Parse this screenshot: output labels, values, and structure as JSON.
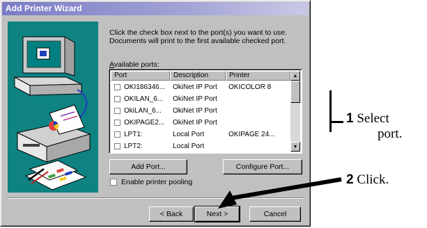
{
  "window": {
    "title": "Add Printer Wizard"
  },
  "instructions": "Click the check box next to the port(s) you want to use. Documents will print to the first available checked port.",
  "available_ports_label": {
    "accel": "A",
    "rest": "vailable ports:"
  },
  "ports_table": {
    "columns": [
      "Port",
      "Description",
      "Printer"
    ],
    "rows": [
      {
        "port": "OKI186346...",
        "description": "OkiNet IP Port",
        "printer": "OKICOLOR 8",
        "checked": false
      },
      {
        "port": "OKILAN_6...",
        "description": "OkiNet IP Port",
        "printer": "",
        "checked": false
      },
      {
        "port": "OkiLAN_6...",
        "description": "OkiNet IP Port",
        "printer": "",
        "checked": false
      },
      {
        "port": "OKIPAGE2...",
        "description": "OkiNet IP Port",
        "printer": "",
        "checked": false
      },
      {
        "port": "LPT1:",
        "description": "Local Port",
        "printer": "OKIPAGE 24...",
        "checked": false
      },
      {
        "port": "LPT2:",
        "description": "Local Port",
        "printer": "",
        "checked": false
      }
    ]
  },
  "buttons": {
    "add_port": "Add Port...",
    "configure_port": "Configure Port...",
    "back": "< Back",
    "next": "Next >",
    "cancel": "Cancel"
  },
  "enable_pooling": {
    "label": "Enable printer pooling",
    "checked": false
  },
  "callouts": {
    "step1_number": "1",
    "step1_line1": "Select",
    "step1_line2": "port.",
    "step2_number": "2",
    "step2_text": "Click."
  },
  "colors": {
    "illustration_bg": "#0f8282",
    "dialog_bg": "#c0c0c0",
    "titlebar": "#7b7bc6"
  }
}
